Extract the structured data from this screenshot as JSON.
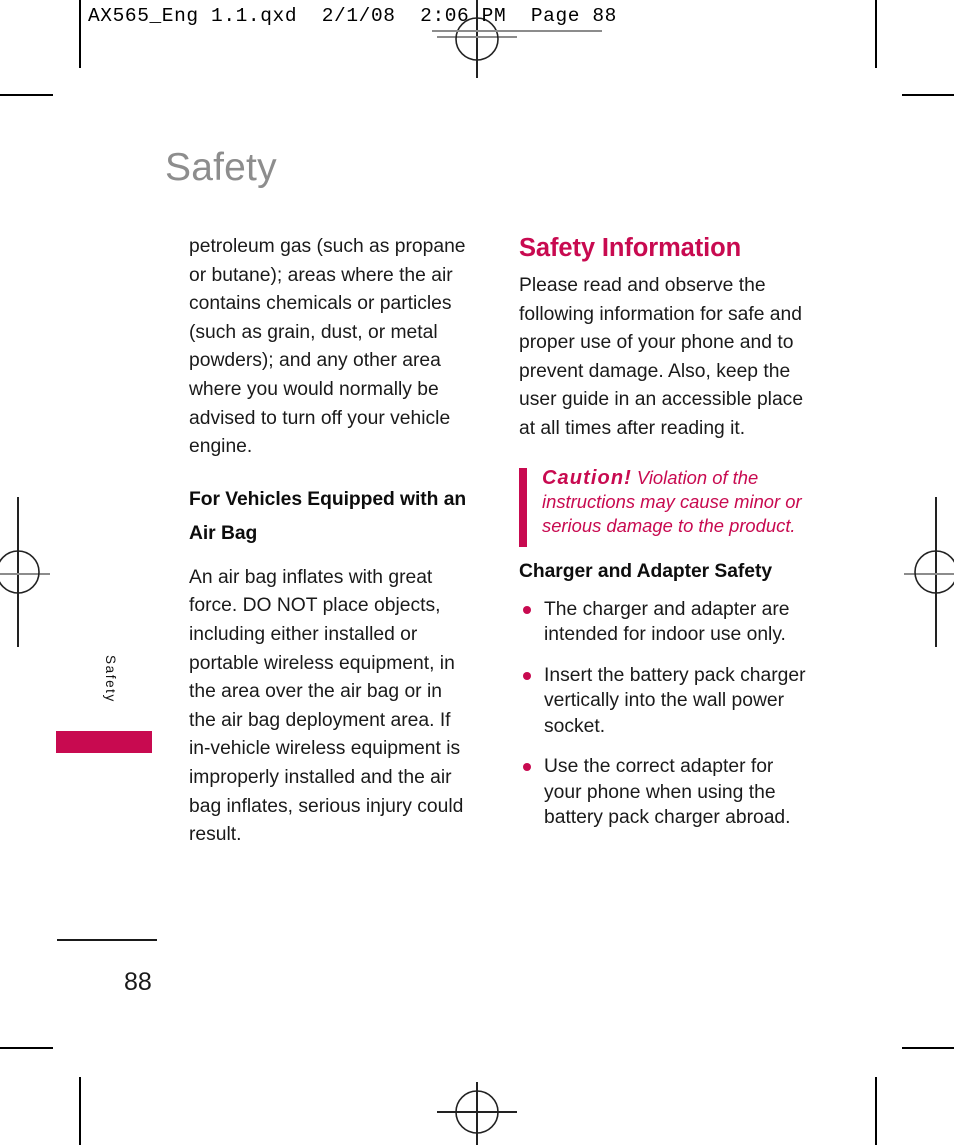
{
  "prepress": {
    "slug": "AX565_Eng 1.1.qxd  2/1/08  2:06 PM  Page 88",
    "registration_icon": "registration-target-icon",
    "crop_mark_icon": "crop-mark-icon"
  },
  "page": {
    "title": "Safety",
    "folio": "88",
    "side_tab_label": "Safety"
  },
  "colors": {
    "accent": "#c80a50",
    "title_grey": "#8d8d8d",
    "body": "#1a1a1a"
  },
  "left_column": {
    "continued_paragraph": "petroleum gas (such as propane or butane); areas where the air contains chemicals or particles (such as grain, dust, or metal powders); and any other area where you would normally be advised to turn off your vehicle engine.",
    "subheading": "For Vehicles Equipped with an Air Bag",
    "air_bag_paragraph": "An air bag inflates with great force. DO NOT place objects, including either installed or portable wireless equipment, in the area over the air bag or in the air bag deployment area. If in-vehicle wireless equipment is improperly installed and the air bag inflates, serious injury could result."
  },
  "right_column": {
    "section_heading": "Safety Information",
    "intro_paragraph": "Please read and observe the following information for safe and proper use of your phone and to prevent damage. Also, keep the user guide in an accessible place at all times after reading it.",
    "caution": {
      "label": "Caution!",
      "text": "Violation of the instructions may cause minor or serious damage to the product."
    },
    "charger_heading": "Charger and Adapter Safety",
    "charger_bullets": [
      "The charger and adapter are intended for indoor use only.",
      "Insert the battery pack charger vertically into the wall power socket.",
      "Use the correct adapter for your phone when using the battery pack charger abroad."
    ]
  }
}
